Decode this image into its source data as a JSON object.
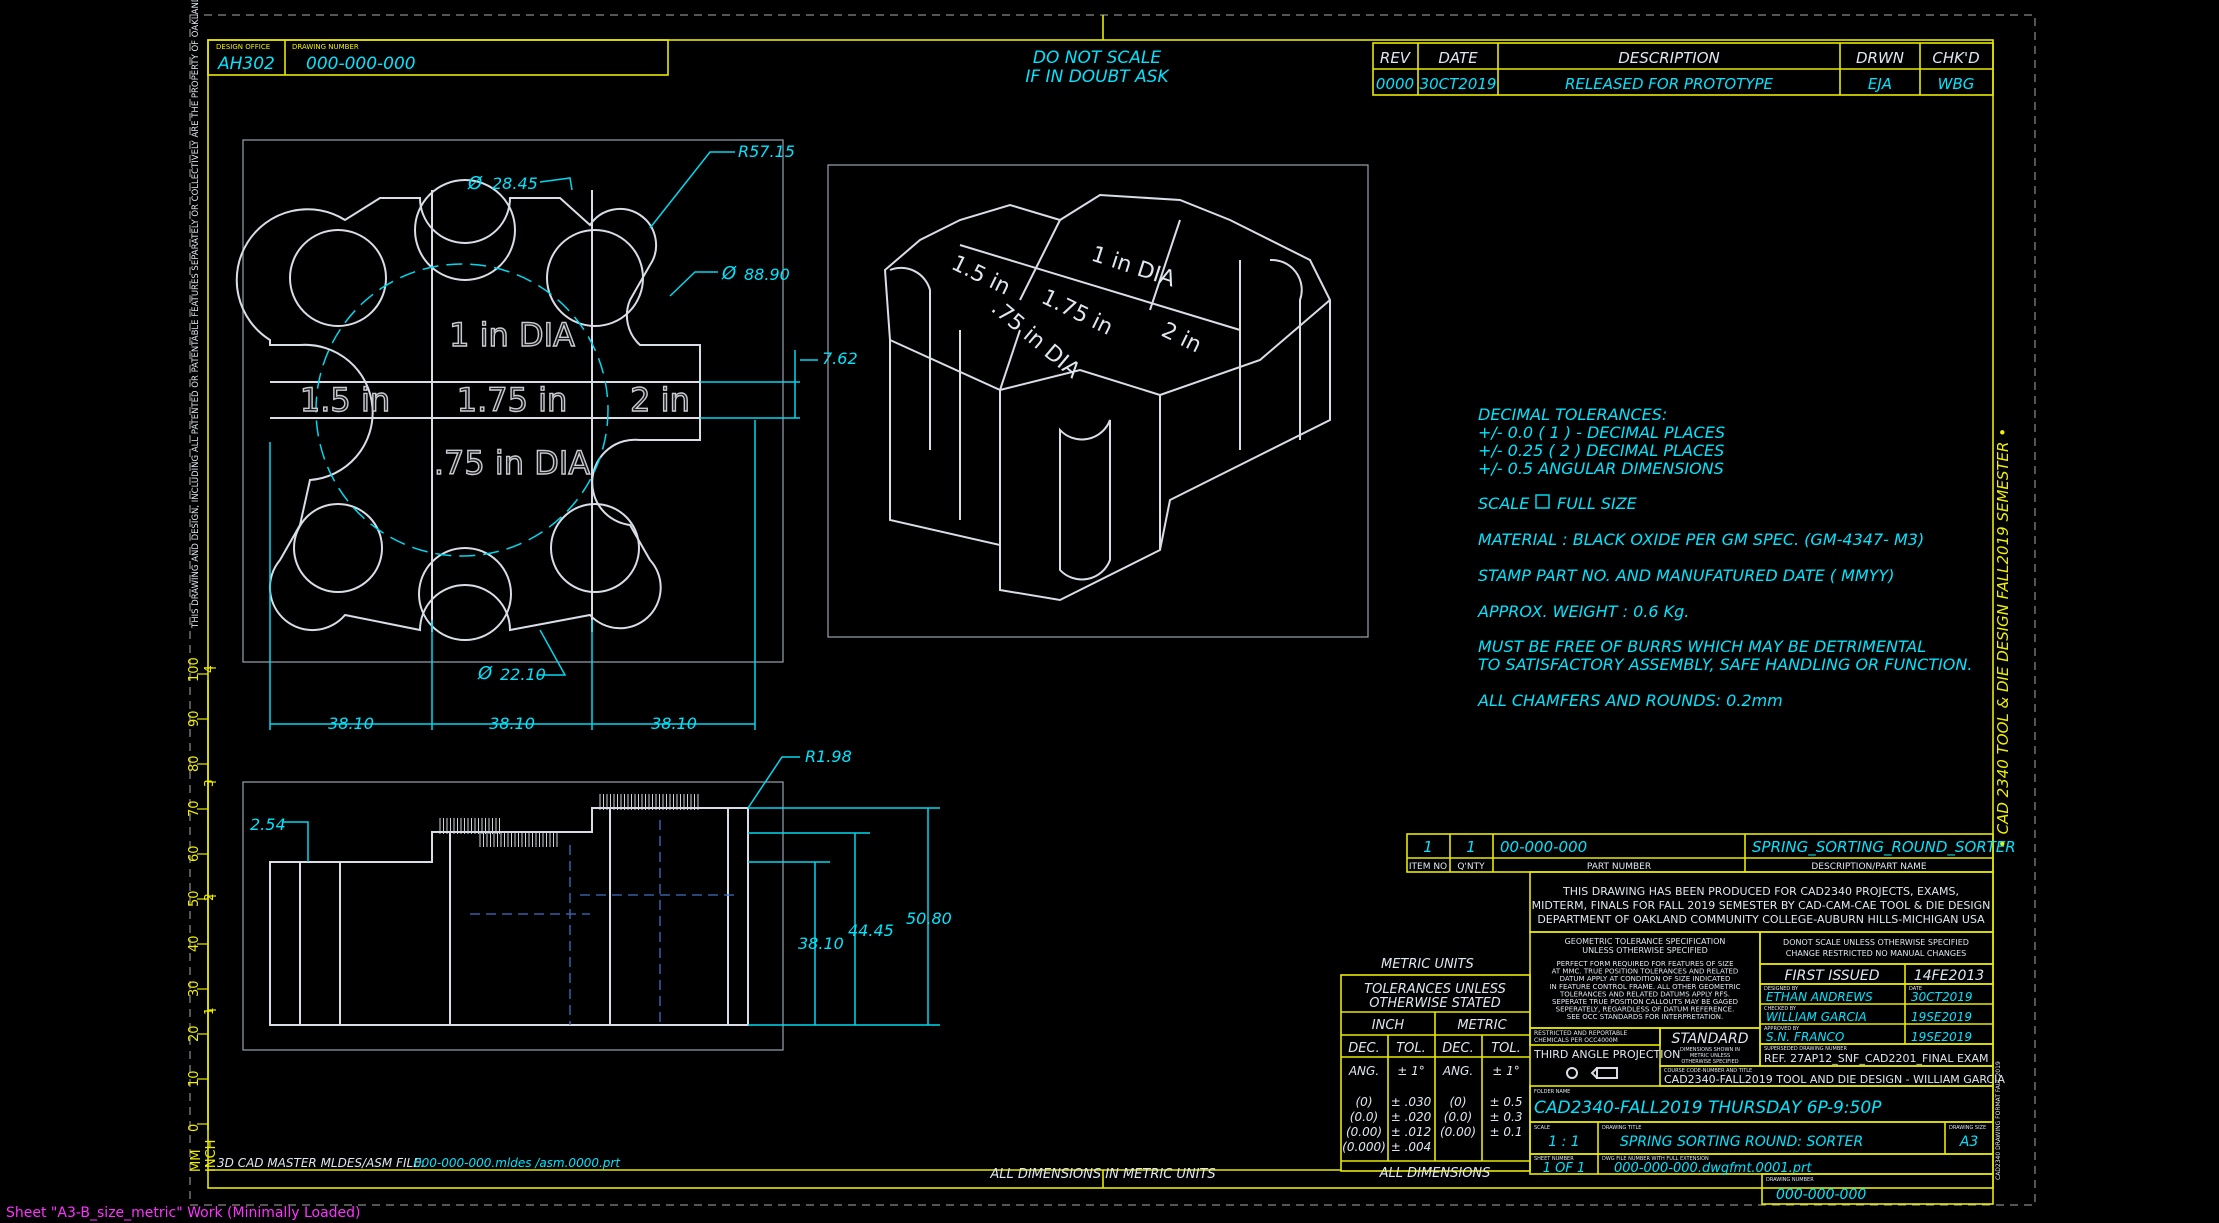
{
  "title_block_top": {
    "design_office_label": "DESIGN OFFICE",
    "design_office": "AH302",
    "drawing_number_label": "DRAWING NUMBER",
    "drawing_number": "000-000-000"
  },
  "do_not_scale": [
    "DO NOT SCALE",
    "IF IN DOUBT ASK"
  ],
  "revision_table": {
    "headers": [
      "REV",
      "DATE",
      "DESCRIPTION",
      "DRWN",
      "CHK'D"
    ],
    "rows": [
      [
        "0000",
        "30CT2019",
        "RELEASED FOR PROTOTYPE",
        "EJA",
        "WBG"
      ]
    ]
  },
  "legal_notice": "THIS DRAWING AND DESIGN, INCLUDING ALL PATENTED OR PATENTABLE FEATURES SEPARATELY OR COLLECTIVELY ARE THE PROPERTY OF OAKLAND COMMUNITY COLLEGE AND ARE NOT TO BE REPRODUCED, COPIED OR EMPLOYED FOR ANY PURPOSE OTHER THAN SPECIFICALLY PERMITTED IN WRITING BY OAKLAND COMMUNITY COLLEGE",
  "side_banner": "• CAD 2340 TOOL & DIE DESIGN FALL2019 SEMESTER •",
  "top_view": {
    "engravings": [
      "1 in DIA",
      "1.5 in",
      "1.75 in",
      "2 in",
      ".75 in DIA"
    ],
    "dims": {
      "dia_slot": "28.45",
      "radius": "R57.15",
      "dia_circle": "88.90",
      "center_band": "7.62",
      "dia_small": "22.10",
      "spacing": [
        "38.10",
        "38.10",
        "38.10"
      ]
    }
  },
  "iso_view": {
    "engravings": [
      "1.5 in",
      "1.75 in",
      "2 in",
      "1 in DIA",
      ".75 in DIA"
    ]
  },
  "front_view": {
    "dims": {
      "r": "R1.98",
      "step": "2.54",
      "h1": "38.10",
      "h2": "44.45",
      "h3": "50.80"
    }
  },
  "notes": [
    "DECIMAL TOLERANCES:",
    "+/- 0.0      ( 1 ) - DECIMAL PLACES",
    "+/- 0.25   ( 2 ) DECIMAL PLACES",
    "+/- 0.5       ANGULAR DIMENSIONS",
    "SCALE",
    "FULL SIZE",
    "MATERIAL :  BLACK OXIDE PER GM SPEC. (GM-4347- M3)",
    "STAMP PART NO. AND MANUFATURED DATE ( MMYY)",
    "APPROX. WEIGHT : 0.6 Kg.",
    "MUST BE FREE OF BURRS WHICH MAY BE DETRIMENTAL",
    "TO SATISFACTORY ASSEMBLY, SAFE HANDLING OR FUNCTION.",
    "ALL CHAMFERS AND ROUNDS: 0.2mm"
  ],
  "parts_list": {
    "row": [
      "1",
      "1",
      "00-000-000",
      "SPRING_SORTING_ROUND_SORTER"
    ],
    "headers": [
      "ITEM NO",
      "Q'NTY",
      "PART NUMBER",
      "DESCRIPTION/PART NAME"
    ]
  },
  "produced_notice": [
    "THIS DRAWING HAS BEEN PRODUCED FOR CAD2340 PROJECTS, EXAMS,",
    "MIDTERM, FINALS FOR FALL 2019 SEMESTER BY CAD-CAM-CAE TOOL & DIE DESIGN",
    "DEPARTMENT OF OAKLAND COMMUNITY COLLEGE-AUBURN HILLS-MICHIGAN USA"
  ],
  "gtol": {
    "title": [
      "GEOMETRIC TOLERANCE SPECIFICATION",
      "UNLESS OTHERWISE SPECIFIED"
    ],
    "body": [
      "PERFECT FORM REQUIRED FOR FEATURES OF SIZE",
      "AT MMC. TRUE POSITION TOLERANCES AND RELATED",
      "DATUM APPLY AT CONDITION OF SIZE INDICATED",
      "IN FEATURE CONTROL FRAME. ALL OTHER GEOMETRIC",
      "TOLERANCES AND RELATED DATUMS APPLY RFS.",
      "SEPERATE TRUE POSITION CALLOUTS MAY BE GAGED",
      "SEPERATELY, REGARDLESS OF DATUM REFERENCE.",
      "SEE OCC STANDARDS FOR INTERPRETATION."
    ],
    "restricted": [
      "RESTRICTED AND REPORTABLE",
      "CHEMICALS PER OCC4000M"
    ],
    "standard": "STANDARD",
    "standard_sub": [
      "DIMENSIONS SHOWN IN",
      "METRIC UNLESS",
      "OTHERWISE SPECIFIED"
    ]
  },
  "metric_units": "METRIC UNITS",
  "tolerances_box": {
    "title": [
      "TOLERANCES UNLESS",
      "OTHERWISE STATED"
    ],
    "inch": "INCH",
    "metric": "METRIC",
    "dec": "DEC.",
    "tol": "TOL.",
    "ang": "ANG.",
    "ang_tol": "± 1°",
    "inch_dec": [
      "(0)",
      "(0.0)",
      "(0.00)",
      "(0.000)"
    ],
    "inch_tol": [
      "± .030",
      "± .020",
      "± .012",
      "± .004"
    ],
    "metric_dec": [
      "(0)",
      "(0.0)",
      "(0.00)"
    ],
    "metric_tol": [
      "± 0.5",
      "± 0.3",
      "± 0.1"
    ],
    "footer": "ALL DIMENSIONS"
  },
  "third_angle": "THIRD ANGLE PROJECTION",
  "title_block": {
    "no_scale": [
      "DONOT SCALE UNLESS OTHERWISE SPECIFIED",
      "CHANGE RESTRICTED NO MANUAL CHANGES"
    ],
    "first_issued_label": "FIRST ISSUED",
    "first_issued": "14FE2013",
    "designed_by_label": "DESIGNED BY",
    "designed_by": "ETHAN ANDREWS",
    "date_label": "DATE",
    "designed_date": "30CT2019",
    "checked_by_label": "CHECKED BY",
    "checked_by": "WILLIAM GARCIA",
    "checked_date": "19SE2019",
    "approved_by_label": "APPROVED BY",
    "approved_by": "S.N. FRANCO",
    "approved_date": "19SE2019",
    "superseded_label": "SUPERSEDED DRAWING NUMBER",
    "superseded": "REF. 27AP12_SNF_CAD2201_FINAL EXAM",
    "course_label": "COURSE CODE-NUMBER AND TITLE",
    "course": "CAD2340-FALL2019  TOOL AND DIE DESIGN - WILLIAM GARCIA",
    "folder_label": "FOLDER NAME",
    "folder": "CAD2340-FALL2019 THURSDAY 6P-9:50P",
    "scale_label": "SCALE",
    "scale": "1 : 1",
    "drawing_title_label": "DRAWING TITLE",
    "drawing_title": "SPRING SORTING ROUND: SORTER",
    "drawing_size_label": "DRAWING SIZE",
    "drawing_size": "A3",
    "sheet_label": "SHEET NUMBER",
    "sheet": "1 OF 1",
    "dwg_file_label": "DWG FILE NUMBER WITH FULL EXTENSION",
    "dwg_file": "000-000-000.dwgfmt.0001.prt",
    "drawing_number_label": "DRAWING NUMBER",
    "drawing_number": "000-000-000",
    "vertical_note": "CAD2340 DRAWING FORMAT FALL 2019"
  },
  "cad_master": "3D CAD MASTER MLDES/ASM FILE:",
  "cad_master_file": "000-000-000.mldes /asm.0000.prt",
  "all_dims_metric": "ALL DIMENSIONS IN METRIC UNITS",
  "ruler": {
    "mm": "MM",
    "inch": "INCH",
    "mm_ticks": [
      "0",
      "10",
      "20",
      "30",
      "40",
      "50",
      "60",
      "70",
      "80",
      "90",
      "100"
    ],
    "inch_ticks": [
      "1",
      "2",
      "3",
      "4"
    ]
  },
  "status_bar": "Sheet \"A3-B_size_metric\" Work (Minimally Loaded)"
}
